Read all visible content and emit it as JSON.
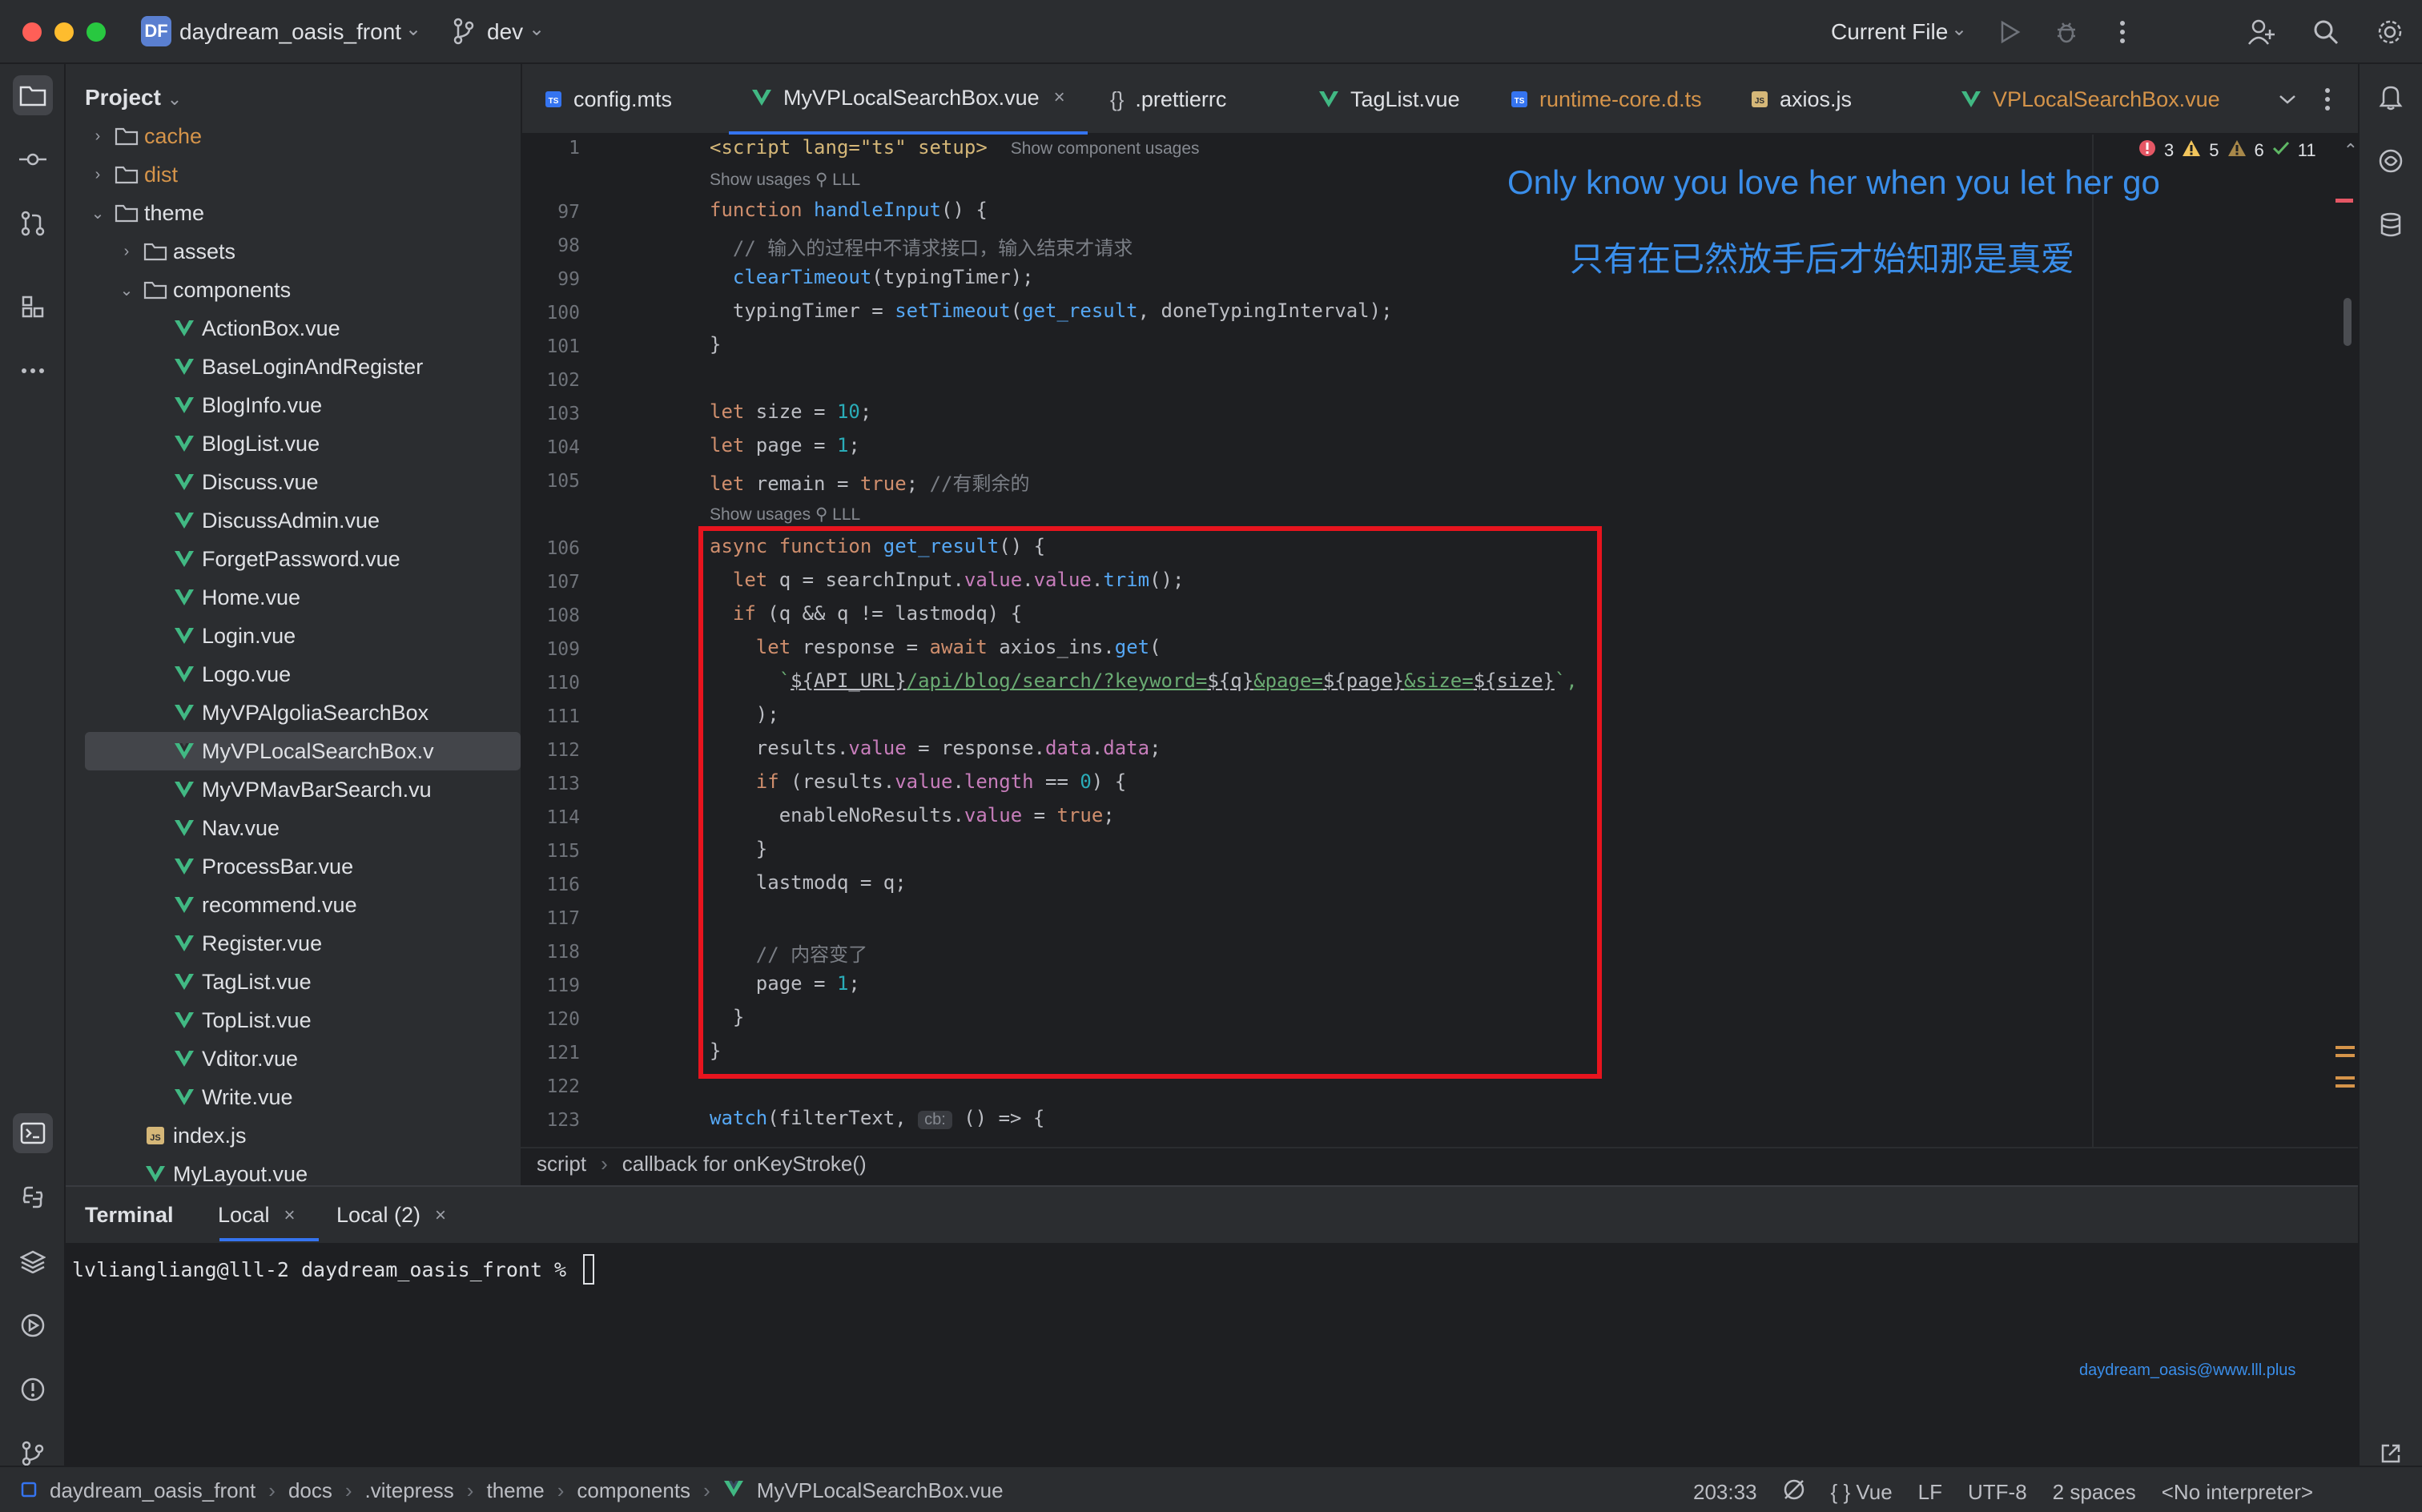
{
  "window": {
    "project_badge": "DF",
    "project_name": "daydream_oasis_front",
    "branch": "dev",
    "run_config": "Current File"
  },
  "project_panel": {
    "title": "Project",
    "tree": [
      {
        "label": "cache",
        "type": "folder",
        "depth": 1,
        "expanded": false,
        "excluded": true
      },
      {
        "label": "dist",
        "type": "folder",
        "depth": 1,
        "expanded": false,
        "excluded": true
      },
      {
        "label": "theme",
        "type": "folder",
        "depth": 1,
        "expanded": true
      },
      {
        "label": "assets",
        "type": "folder",
        "depth": 2,
        "expanded": false
      },
      {
        "label": "components",
        "type": "folder",
        "depth": 2,
        "expanded": true
      },
      {
        "label": "ActionBox.vue",
        "type": "vue",
        "depth": 3
      },
      {
        "label": "BaseLoginAndRegister",
        "type": "vue",
        "depth": 3
      },
      {
        "label": "BlogInfo.vue",
        "type": "vue",
        "depth": 3
      },
      {
        "label": "BlogList.vue",
        "type": "vue",
        "depth": 3
      },
      {
        "label": "Discuss.vue",
        "type": "vue",
        "depth": 3
      },
      {
        "label": "DiscussAdmin.vue",
        "type": "vue",
        "depth": 3
      },
      {
        "label": "ForgetPassword.vue",
        "type": "vue",
        "depth": 3
      },
      {
        "label": "Home.vue",
        "type": "vue",
        "depth": 3
      },
      {
        "label": "Login.vue",
        "type": "vue",
        "depth": 3
      },
      {
        "label": "Logo.vue",
        "type": "vue",
        "depth": 3
      },
      {
        "label": "MyVPAlgoliaSearchBox",
        "type": "vue",
        "depth": 3
      },
      {
        "label": "MyVPLocalSearchBox.v",
        "type": "vue",
        "depth": 3,
        "selected": true
      },
      {
        "label": "MyVPMavBarSearch.vu",
        "type": "vue",
        "depth": 3
      },
      {
        "label": "Nav.vue",
        "type": "vue",
        "depth": 3
      },
      {
        "label": "ProcessBar.vue",
        "type": "vue",
        "depth": 3
      },
      {
        "label": "recommend.vue",
        "type": "vue",
        "depth": 3
      },
      {
        "label": "Register.vue",
        "type": "vue",
        "depth": 3
      },
      {
        "label": "TagList.vue",
        "type": "vue",
        "depth": 3
      },
      {
        "label": "TopList.vue",
        "type": "vue",
        "depth": 3
      },
      {
        "label": "Vditor.vue",
        "type": "vue",
        "depth": 3
      },
      {
        "label": "Write.vue",
        "type": "vue",
        "depth": 3
      },
      {
        "label": "index.js",
        "type": "js",
        "depth": 2
      },
      {
        "label": "MyLayout.vue",
        "type": "vue",
        "depth": 2
      }
    ]
  },
  "tabs": [
    {
      "label": "config.mts",
      "icon": "ts"
    },
    {
      "label": "MyVPLocalSearchBox.vue",
      "icon": "vue",
      "active": true
    },
    {
      "label": ".prettierrc",
      "icon": "json"
    },
    {
      "label": "TagList.vue",
      "icon": "vue"
    },
    {
      "label": "runtime-core.d.ts",
      "icon": "ts",
      "warn": true
    },
    {
      "label": "axios.js",
      "icon": "js"
    },
    {
      "label": "VPLocalSearchBox.vue",
      "icon": "vue",
      "warn": true
    }
  ],
  "editor": {
    "inspections": {
      "errors": "3",
      "warnings": "5",
      "weak_warnings": "6",
      "ok": "11"
    },
    "line1": {
      "num": "1",
      "code": "<script lang=\"ts\" setup>",
      "hint": "Show component usages"
    },
    "usage_hint": "Show usages",
    "usage_author": "LLL",
    "overlay_en": "Only know you love her when you let her go",
    "overlay_zh": "只有在已然放手后才始知那是真爱",
    "line_numbers": [
      "97",
      "98",
      "99",
      "100",
      "101",
      "102",
      "103",
      "104",
      "105",
      "106",
      "107",
      "108",
      "109",
      "110",
      "111",
      "112",
      "113",
      "114",
      "115",
      "116",
      "117",
      "118",
      "119",
      "120",
      "121",
      "122",
      "123"
    ],
    "code": {
      "l97_kw": "function",
      "l97_fn": "handleInput",
      "l97_rest": "() {",
      "l98": "  // 输入的过程中不请求接口，输入结束才请求",
      "l99_fn": "clearTimeout",
      "l99_rest": "(typingTimer);",
      "l100_a": "  typingTimer = ",
      "l100_fn": "setTimeout",
      "l100_b": "(",
      "l100_c": "get_result",
      "l100_d": ", doneTypingInterval);",
      "l101": "}",
      "l103_kw": "let",
      "l103_a": " size = ",
      "l103_n": "10",
      "l103_b": ";",
      "l104_kw": "let",
      "l104_a": " page = ",
      "l104_n": "1",
      "l104_b": ";",
      "l105_kw": "let",
      "l105_a": " remain = ",
      "l105_v": "true",
      "l105_b": "; ",
      "l105_c": "//有剩余的",
      "l106_kw": "async function",
      "l106_fn": "get_result",
      "l106_rest": "() {",
      "l107_kw": "let",
      "l107_a": " q = searchInput.",
      "l107_p1": "value",
      "l107_b": ".",
      "l107_p2": "value",
      "l107_c": ".",
      "l107_fn": "trim",
      "l107_d": "();",
      "l108_kw": "if",
      "l108_rest": " (q && q != lastmodq) {",
      "l109_kw1": "let",
      "l109_a": " response = ",
      "l109_kw2": "await",
      "l109_b": " axios_ins.",
      "l109_fn": "get",
      "l109_c": "(",
      "l110_tick": "`",
      "l110_t1": "${API_URL}",
      "l110_u1": "/api/blog/search/?keyword=",
      "l110_t2": "${q}",
      "l110_u2": "&page=",
      "l110_t3": "${page}",
      "l110_u3": "&size=",
      "l110_t4": "${size}",
      "l110_end": "`,",
      "l111": ");",
      "l112_a": "results.",
      "l112_p1": "value",
      "l112_b": " = response.",
      "l112_p2": "data",
      "l112_c": ".",
      "l112_p3": "data",
      "l112_d": ";",
      "l113_kw": "if",
      "l113_a": " (results.",
      "l113_p1": "value",
      "l113_b": ".",
      "l113_p2": "length",
      "l113_c": " == ",
      "l113_n": "0",
      "l113_d": ") {",
      "l114_a": "enableNoResults.",
      "l114_p": "value",
      "l114_b": " = ",
      "l114_v": "true",
      "l114_c": ";",
      "l115": "}",
      "l116": "lastmodq = q;",
      "l118": "// 内容变了",
      "l119_a": "page = ",
      "l119_n": "1",
      "l119_b": ";",
      "l120": "}",
      "l121": "}",
      "l123_fn": "watch",
      "l123_a": "(filterText, ",
      "l123_hint": "cb:",
      "l123_b": " () => {"
    }
  },
  "editor_breadcrumb": [
    "script",
    "callback for onKeyStroke()"
  ],
  "terminal": {
    "title": "Terminal",
    "tabs": [
      "Local",
      "Local (2)"
    ],
    "prompt": "lvliangliang@lll-2 daydream_oasis_front % ",
    "watermark": "daydream_oasis@www.lll.plus"
  },
  "statusbar": {
    "crumbs": [
      "daydream_oasis_front",
      "docs",
      ".vitepress",
      "theme",
      "components",
      "MyVPLocalSearchBox.vue"
    ],
    "position": "203:33",
    "lang": "Vue",
    "line_sep": "LF",
    "encoding": "UTF-8",
    "indent": "2 spaces",
    "interpreter": "<No interpreter>"
  },
  "colors": {
    "accent": "#3574f0",
    "highlight_box": "#e8141e",
    "overlay_text": "#3a8eea",
    "vue_green": "#41b883"
  }
}
